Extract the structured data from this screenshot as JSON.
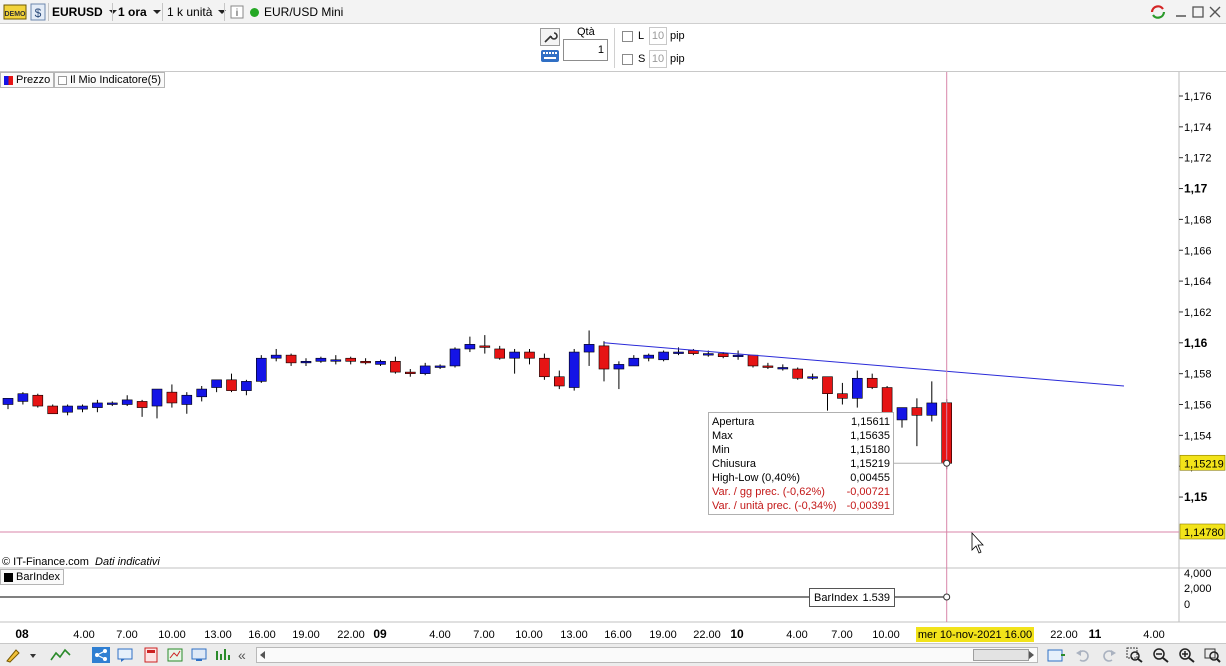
{
  "toolbar": {
    "demo_badge": "DEMO",
    "symbol": "EURUSD",
    "timeframe": "1 ora",
    "units": "1 k unità",
    "instrument_name": "EUR/USD Mini"
  },
  "order_panel": {
    "qty_label": "Qtà",
    "qty_value": "1",
    "long_label": "L",
    "short_label": "S",
    "long_pips": "10",
    "short_pips": "10",
    "pip_label": "pip"
  },
  "legend": {
    "price_label": "Prezzo",
    "indicator_label": "Il Mio Indicatore(5)"
  },
  "copyright": "© IT-Finance.com",
  "disclaimer": "Dati indicativi",
  "tooltip": {
    "rows": [
      {
        "label": "Apertura",
        "value": "1,15611"
      },
      {
        "label": "Max",
        "value": "1,15635"
      },
      {
        "label": "Min",
        "value": "1,15180"
      },
      {
        "label": "Chiusura",
        "value": "1,15219"
      },
      {
        "label": "High-Low (0,40%)",
        "value": "0,00455"
      }
    ],
    "red_rows": [
      {
        "label": "Var. / gg prec. (-0,62%)",
        "value": "-0,00721"
      },
      {
        "label": "Var. / unità prec. (-0,34%)",
        "value": "-0,00391"
      }
    ]
  },
  "price_axis": {
    "ticks": [
      "1,176",
      "1,174",
      "1,172",
      "1,17",
      "1,168",
      "1,166",
      "1,164",
      "1,162",
      "1,16",
      "1,158",
      "1,156",
      "1,154",
      "1,152",
      "1,15"
    ],
    "bold_ticks": [
      "1,17",
      "1,16",
      "1,15"
    ],
    "current_price": "1,15219",
    "cursor_price": "1,14780"
  },
  "barindex": {
    "panel_label": "BarIndex",
    "value_label": "BarIndex",
    "value": "1.539",
    "axis_ticks": [
      "4,000",
      "2,000",
      "0"
    ]
  },
  "time_axis": {
    "labels": [
      "08",
      "4.00",
      "7.00",
      "10.00",
      "13.00",
      "16.00",
      "19.00",
      "22.00",
      "09",
      "4.00",
      "7.00",
      "10.00",
      "13.00",
      "16.00",
      "19.00",
      "22.00",
      "10",
      "4.00",
      "7.00",
      "10.00",
      "22.00",
      "11",
      "4.00"
    ],
    "bold_labels": [
      "08",
      "09",
      "10",
      "11"
    ],
    "cursor_date": "mer 10-nov-2021 16.00"
  },
  "colors": {
    "up_candle": "#1414e6",
    "down_candle": "#e61414",
    "trendline": "#2a2ad8",
    "crosshair": "#d886a8",
    "highlight": "#f2e31a"
  },
  "chart_data": {
    "type": "candlestick",
    "title": "",
    "ylim": [
      1.1465,
      1.1775
    ],
    "candles": [
      {
        "o": 1.156,
        "h": 1.1563,
        "l": 1.1557,
        "c": 1.1564
      },
      {
        "o": 1.1562,
        "h": 1.1568,
        "l": 1.156,
        "c": 1.1567
      },
      {
        "o": 1.1566,
        "h": 1.1567,
        "l": 1.1558,
        "c": 1.1559
      },
      {
        "o": 1.1559,
        "h": 1.156,
        "l": 1.1554,
        "c": 1.1554
      },
      {
        "o": 1.1555,
        "h": 1.156,
        "l": 1.1553,
        "c": 1.1559
      },
      {
        "o": 1.1557,
        "h": 1.156,
        "l": 1.1555,
        "c": 1.1559
      },
      {
        "o": 1.1558,
        "h": 1.1563,
        "l": 1.1555,
        "c": 1.1561
      },
      {
        "o": 1.156,
        "h": 1.1562,
        "l": 1.1559,
        "c": 1.1561
      },
      {
        "o": 1.156,
        "h": 1.1566,
        "l": 1.1559,
        "c": 1.1563
      },
      {
        "o": 1.1562,
        "h": 1.1563,
        "l": 1.1552,
        "c": 1.1558
      },
      {
        "o": 1.1559,
        "h": 1.157,
        "l": 1.1551,
        "c": 1.157
      },
      {
        "o": 1.1568,
        "h": 1.1573,
        "l": 1.1558,
        "c": 1.1561
      },
      {
        "o": 1.156,
        "h": 1.1568,
        "l": 1.1554,
        "c": 1.1566
      },
      {
        "o": 1.1565,
        "h": 1.1572,
        "l": 1.1562,
        "c": 1.157
      },
      {
        "o": 1.1571,
        "h": 1.1576,
        "l": 1.1568,
        "c": 1.1576
      },
      {
        "o": 1.1576,
        "h": 1.158,
        "l": 1.1568,
        "c": 1.1569
      },
      {
        "o": 1.1569,
        "h": 1.1576,
        "l": 1.1566,
        "c": 1.1575
      },
      {
        "o": 1.1575,
        "h": 1.1592,
        "l": 1.1574,
        "c": 1.159
      },
      {
        "o": 1.159,
        "h": 1.1596,
        "l": 1.1588,
        "c": 1.1592
      },
      {
        "o": 1.1592,
        "h": 1.1593,
        "l": 1.1585,
        "c": 1.1587
      },
      {
        "o": 1.1587,
        "h": 1.159,
        "l": 1.1585,
        "c": 1.1588
      },
      {
        "o": 1.1588,
        "h": 1.1591,
        "l": 1.1587,
        "c": 1.159
      },
      {
        "o": 1.1589,
        "h": 1.1592,
        "l": 1.1586,
        "c": 1.1589
      },
      {
        "o": 1.159,
        "h": 1.1591,
        "l": 1.1586,
        "c": 1.1588
      },
      {
        "o": 1.1588,
        "h": 1.159,
        "l": 1.1586,
        "c": 1.1587
      },
      {
        "o": 1.1586,
        "h": 1.1589,
        "l": 1.1585,
        "c": 1.1588
      },
      {
        "o": 1.1588,
        "h": 1.1591,
        "l": 1.158,
        "c": 1.1581
      },
      {
        "o": 1.1581,
        "h": 1.1583,
        "l": 1.1578,
        "c": 1.158
      },
      {
        "o": 1.158,
        "h": 1.1587,
        "l": 1.1579,
        "c": 1.1585
      },
      {
        "o": 1.1584,
        "h": 1.1586,
        "l": 1.1583,
        "c": 1.1585
      },
      {
        "o": 1.1585,
        "h": 1.1597,
        "l": 1.1584,
        "c": 1.1596
      },
      {
        "o": 1.1596,
        "h": 1.1604,
        "l": 1.1594,
        "c": 1.1599
      },
      {
        "o": 1.1598,
        "h": 1.1605,
        "l": 1.1593,
        "c": 1.1597
      },
      {
        "o": 1.1596,
        "h": 1.1598,
        "l": 1.1589,
        "c": 1.159
      },
      {
        "o": 1.159,
        "h": 1.1596,
        "l": 1.158,
        "c": 1.1594
      },
      {
        "o": 1.1594,
        "h": 1.1596,
        "l": 1.1586,
        "c": 1.159
      },
      {
        "o": 1.159,
        "h": 1.1593,
        "l": 1.1576,
        "c": 1.1578
      },
      {
        "o": 1.1578,
        "h": 1.1582,
        "l": 1.157,
        "c": 1.1572
      },
      {
        "o": 1.1571,
        "h": 1.1596,
        "l": 1.1569,
        "c": 1.1594
      },
      {
        "o": 1.1594,
        "h": 1.1608,
        "l": 1.1585,
        "c": 1.1599
      },
      {
        "o": 1.1598,
        "h": 1.1601,
        "l": 1.1575,
        "c": 1.1583
      },
      {
        "o": 1.1583,
        "h": 1.1588,
        "l": 1.157,
        "c": 1.1586
      },
      {
        "o": 1.1585,
        "h": 1.1592,
        "l": 1.1585,
        "c": 1.159
      },
      {
        "o": 1.159,
        "h": 1.1593,
        "l": 1.1588,
        "c": 1.1592
      },
      {
        "o": 1.1589,
        "h": 1.1595,
        "l": 1.1588,
        "c": 1.1594
      },
      {
        "o": 1.1594,
        "h": 1.1597,
        "l": 1.1592,
        "c": 1.1594
      },
      {
        "o": 1.1595,
        "h": 1.1596,
        "l": 1.1592,
        "c": 1.1593
      },
      {
        "o": 1.1593,
        "h": 1.1595,
        "l": 1.1591,
        "c": 1.1593
      },
      {
        "o": 1.1593,
        "h": 1.1594,
        "l": 1.159,
        "c": 1.1591
      },
      {
        "o": 1.1592,
        "h": 1.1595,
        "l": 1.1589,
        "c": 1.1592
      },
      {
        "o": 1.1592,
        "h": 1.1592,
        "l": 1.1584,
        "c": 1.1585
      },
      {
        "o": 1.1585,
        "h": 1.1587,
        "l": 1.1583,
        "c": 1.1584
      },
      {
        "o": 1.1584,
        "h": 1.1586,
        "l": 1.1582,
        "c": 1.1584
      },
      {
        "o": 1.1583,
        "h": 1.1584,
        "l": 1.1576,
        "c": 1.1577
      },
      {
        "o": 1.1577,
        "h": 1.158,
        "l": 1.1576,
        "c": 1.1578
      },
      {
        "o": 1.1578,
        "h": 1.1578,
        "l": 1.1556,
        "c": 1.1567
      },
      {
        "o": 1.1567,
        "h": 1.1574,
        "l": 1.156,
        "c": 1.1564
      },
      {
        "o": 1.1564,
        "h": 1.1582,
        "l": 1.1558,
        "c": 1.1577
      },
      {
        "o": 1.1577,
        "h": 1.158,
        "l": 1.157,
        "c": 1.1571
      },
      {
        "o": 1.1571,
        "h": 1.1572,
        "l": 1.1547,
        "c": 1.1549
      },
      {
        "o": 1.155,
        "h": 1.1558,
        "l": 1.1545,
        "c": 1.1558
      },
      {
        "o": 1.1558,
        "h": 1.1564,
        "l": 1.1533,
        "c": 1.1553
      },
      {
        "o": 1.1553,
        "h": 1.1575,
        "l": 1.1549,
        "c": 1.1561
      },
      {
        "o": 1.15611,
        "h": 1.15635,
        "l": 1.1518,
        "c": 1.15219
      }
    ],
    "trendline": {
      "from_index": 40,
      "from_price": 1.16,
      "to_index": 72,
      "to_price": 1.1572
    }
  }
}
